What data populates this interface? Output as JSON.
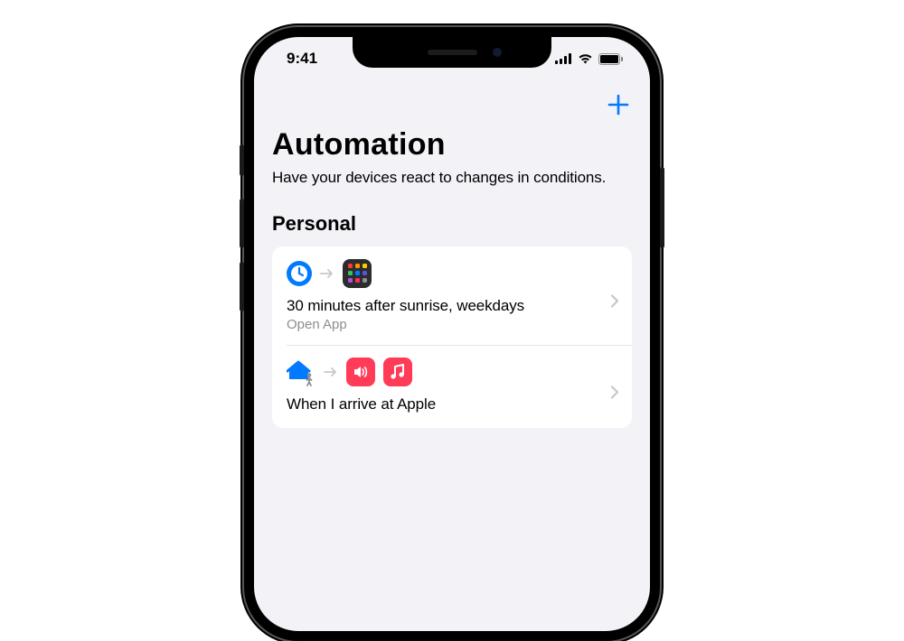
{
  "status": {
    "time": "9:41"
  },
  "page": {
    "title": "Automation",
    "subtitle": "Have your devices react to changes in conditions."
  },
  "section": {
    "header": "Personal"
  },
  "automations": [
    {
      "title": "30 minutes after sunrise, weekdays",
      "subtitle": "Open App"
    },
    {
      "title": "When I arrive at Apple",
      "subtitle": ""
    }
  ],
  "grid_colors": [
    "#ff3b30",
    "#ff9500",
    "#ffcc00",
    "#34c759",
    "#007aff",
    "#5856d6",
    "#af52de",
    "#ff2d55",
    "#8e8e93"
  ]
}
